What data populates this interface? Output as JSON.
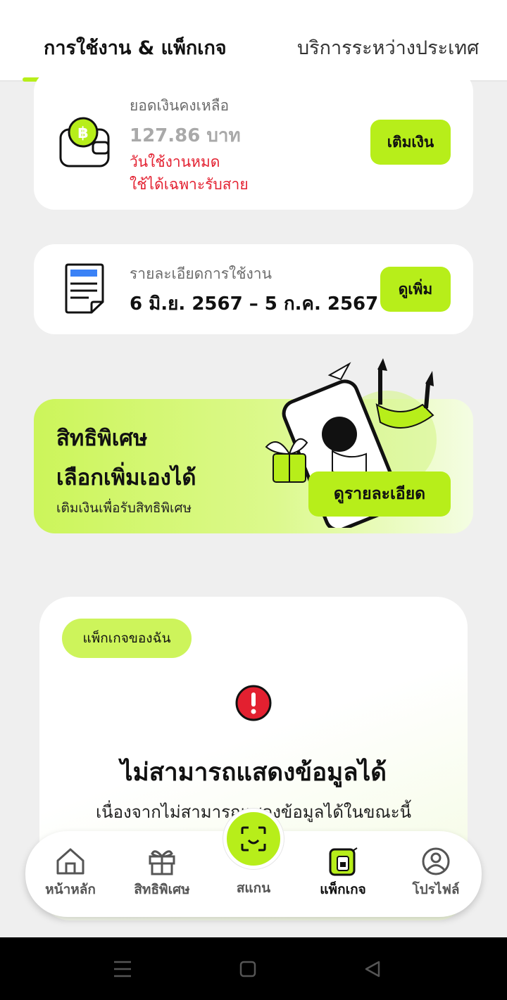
{
  "tabs": {
    "usage": "การใช้งาน & แพ็กเกจ",
    "international": "บริการระหว่างประเทศ"
  },
  "balance": {
    "label": "ยอดเงินคงเหลือ",
    "amount": "127.86 บาท",
    "status_line1": "วันใช้งานหมด",
    "status_line2": "ใช้ได้เฉพาะรับสาย",
    "topup_label": "เติมเงิน"
  },
  "usage_detail": {
    "label": "รายละเอียดการใช้งาน",
    "period": "6 มิ.ย. 2567 – 5 ก.ค. 2567",
    "more_label": "ดูเพิ่ม"
  },
  "promo": {
    "title_line1": "สิทธิพิเศษ",
    "title_line2": "เลือกเพิ่มเองได้",
    "subtitle": "เติมเงินเพื่อรับสิทธิพิเศษ",
    "button_label": "ดูรายละเอียด"
  },
  "package": {
    "badge": "แพ็กเกจของฉัน",
    "error_title": "ไม่สามารถแสดงข้อมูลได้",
    "error_subtitle": "เนื่องจากไม่สามารถแสดงข้อมูลได้ในขณะนี้"
  },
  "bottom_nav": {
    "home": "หน้าหลัก",
    "privileges": "สิทธิพิเศษ",
    "scan": "สแกน",
    "package": "แพ็กเกจ",
    "profile": "โปรไฟล์"
  },
  "colors": {
    "accent": "#b7ee1a",
    "error_red": "#e32030",
    "text_dark": "#111111"
  }
}
